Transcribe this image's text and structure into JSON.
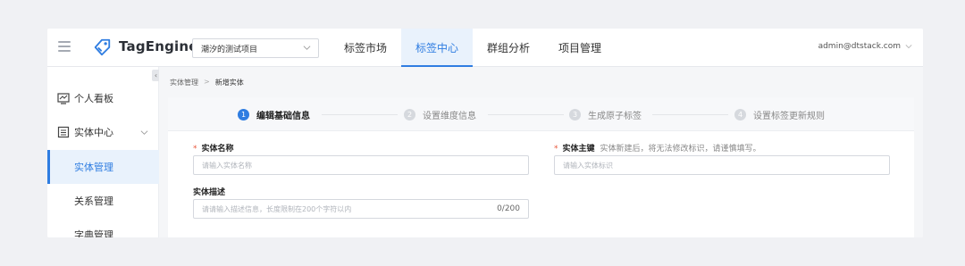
{
  "header": {
    "logo_text": "TagEngine",
    "project_select": "潮汐的测试项目",
    "nav": [
      "标签市场",
      "标签中心",
      "群组分析",
      "项目管理"
    ],
    "user": "admin@dtstack.com",
    "accent": "#2f7de1"
  },
  "sidebar": {
    "items": [
      {
        "label": "个人看板",
        "icon": "dashboard-icon"
      },
      {
        "label": "实体中心",
        "icon": "list-icon"
      }
    ],
    "subitems": [
      "实体管理",
      "关系管理",
      "字典管理"
    ],
    "collapse_glyph": "‹"
  },
  "breadcrumb": {
    "parent": "实体管理",
    "sep": ">",
    "current": "新增实体"
  },
  "steps": [
    {
      "num": "1",
      "label": "编辑基础信息"
    },
    {
      "num": "2",
      "label": "设置维度信息"
    },
    {
      "num": "3",
      "label": "生成原子标签"
    },
    {
      "num": "4",
      "label": "设置标签更新规则"
    }
  ],
  "form": {
    "required_mark": "*",
    "entity_name": {
      "label": "实体名称",
      "placeholder": "请输入实体名称"
    },
    "entity_key": {
      "label": "实体主键",
      "hint": "实体新建后，将无法修改标识，请谨慎填写。",
      "placeholder": "请输入实体标识"
    },
    "entity_desc": {
      "label": "实体描述",
      "placeholder": "请请输入描述信息，长度限制在200个字符以内",
      "count": "0/200"
    }
  }
}
